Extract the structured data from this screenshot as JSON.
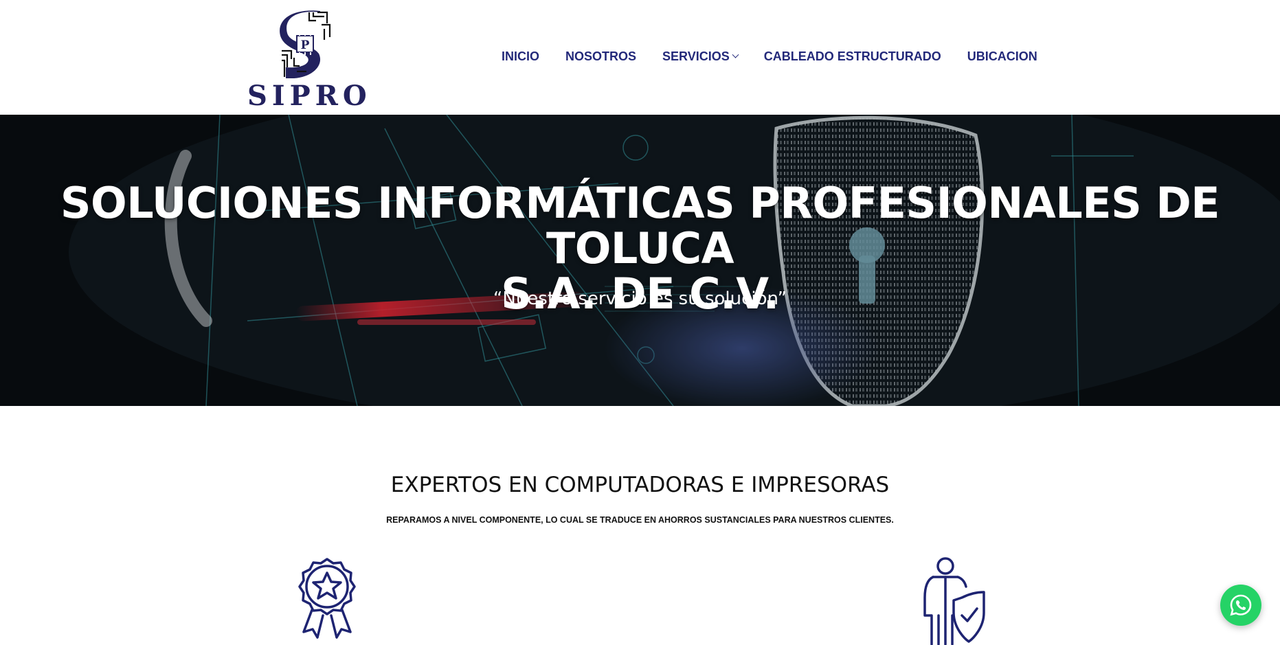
{
  "brand": {
    "name": "SIPRO",
    "logo_icon": "sipro-chip-s-logo"
  },
  "nav": {
    "items": [
      {
        "label": "INICIO",
        "has_dropdown": false
      },
      {
        "label": "NOSOTROS",
        "has_dropdown": false
      },
      {
        "label": "SERVICIOS",
        "has_dropdown": true
      },
      {
        "label": "CABLEADO ESTRUCTURADO",
        "has_dropdown": false
      },
      {
        "label": "UBICACION",
        "has_dropdown": false
      }
    ]
  },
  "hero": {
    "title_line1": "SOLUCIONES INFORMÁTICAS PROFESIONALES DE TOLUCA",
    "title_line2": "S.A. DE C.V.",
    "subtitle": "“Nuestro servicio es su solución”",
    "background_icon": "cyber-security-shield-image"
  },
  "section": {
    "title": "EXPERTOS EN COMPUTADORAS E IMPRESORAS",
    "subtitle": "REPARAMOS A NIVEL COMPONENTE, LO CUAL SE TRADUCE EN AHORROS SUSTANCIALES PARA NUESTROS CLIENTES."
  },
  "features": [
    {
      "icon": "award-badge-icon"
    },
    {
      "icon": "person-shield-icon"
    }
  ],
  "whatsapp": {
    "icon": "whatsapp-icon"
  },
  "colors": {
    "nav": "#23297a",
    "logo": "#23225e",
    "whatsapp": "#25d366",
    "icon_stroke": "#1e2472"
  }
}
